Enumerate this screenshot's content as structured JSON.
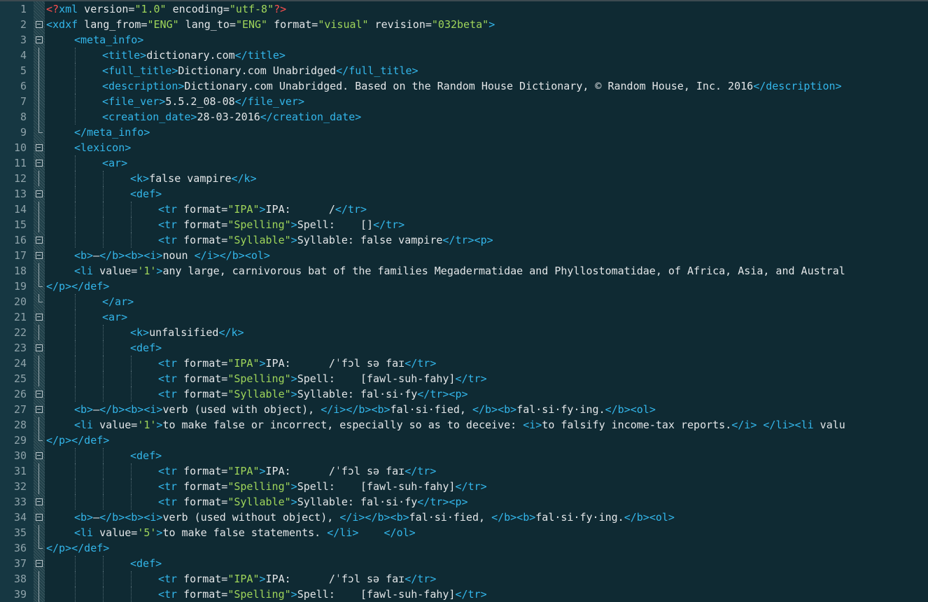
{
  "editor": {
    "language": "xml",
    "colors": {
      "background": "#0f2a33",
      "tag": "#33b6ea",
      "attribute": "#e3e6e8",
      "value": "#9fd55a",
      "text": "#e3e6e8",
      "processing_instruction": "#ff4f4f",
      "line_number": "#8fa3aa"
    },
    "lines": [
      {
        "n": "1",
        "indent": 0,
        "fold": "none",
        "tokens": [
          {
            "k": "p",
            "s": "<?"
          },
          {
            "k": "t",
            "s": "xml"
          },
          {
            "k": "a",
            "s": " version="
          },
          {
            "k": "v",
            "s": "\"1.0\""
          },
          {
            "k": "a",
            "s": " encoding="
          },
          {
            "k": "v",
            "s": "\"utf-8\""
          },
          {
            "k": "p",
            "s": "?>"
          }
        ]
      },
      {
        "n": "2",
        "indent": 0,
        "fold": "box",
        "tokens": [
          {
            "k": "t",
            "s": "<xdxf"
          },
          {
            "k": "a",
            "s": " lang_from="
          },
          {
            "k": "v",
            "s": "\"ENG\""
          },
          {
            "k": "a",
            "s": " lang_to="
          },
          {
            "k": "v",
            "s": "\"ENG\""
          },
          {
            "k": "a",
            "s": " format="
          },
          {
            "k": "v",
            "s": "\"visual\""
          },
          {
            "k": "a",
            "s": " revision="
          },
          {
            "k": "v",
            "s": "\"032beta\""
          },
          {
            "k": "t",
            "s": ">"
          }
        ]
      },
      {
        "n": "3",
        "indent": 1,
        "fold": "box",
        "tokens": [
          {
            "k": "t",
            "s": "<meta_info>"
          }
        ]
      },
      {
        "n": "4",
        "indent": 2,
        "fold": "vl",
        "tokens": [
          {
            "k": "t",
            "s": "<title>"
          },
          {
            "k": "x",
            "s": "dictionary.com"
          },
          {
            "k": "t",
            "s": "</title>"
          }
        ]
      },
      {
        "n": "5",
        "indent": 2,
        "fold": "vl",
        "tokens": [
          {
            "k": "t",
            "s": "<full_title>"
          },
          {
            "k": "x",
            "s": "Dictionary.com Unabridged"
          },
          {
            "k": "t",
            "s": "</full_title>"
          }
        ]
      },
      {
        "n": "6",
        "indent": 2,
        "fold": "vl",
        "tokens": [
          {
            "k": "t",
            "s": "<description>"
          },
          {
            "k": "x",
            "s": "Dictionary.com Unabridged. Based on the Random House Dictionary, © Random House, Inc. 2016"
          },
          {
            "k": "t",
            "s": "</description>"
          }
        ]
      },
      {
        "n": "7",
        "indent": 2,
        "fold": "vl",
        "tokens": [
          {
            "k": "t",
            "s": "<file_ver>"
          },
          {
            "k": "x",
            "s": "5.5.2_08-08"
          },
          {
            "k": "t",
            "s": "</file_ver>"
          }
        ]
      },
      {
        "n": "8",
        "indent": 2,
        "fold": "vl",
        "tokens": [
          {
            "k": "t",
            "s": "<creation_date>"
          },
          {
            "k": "x",
            "s": "28-03-2016"
          },
          {
            "k": "t",
            "s": "</creation_date>"
          }
        ]
      },
      {
        "n": "9",
        "indent": 1,
        "fold": "end",
        "tokens": [
          {
            "k": "t",
            "s": "</meta_info>"
          }
        ]
      },
      {
        "n": "10",
        "indent": 1,
        "fold": "box",
        "tokens": [
          {
            "k": "t",
            "s": "<lexicon>"
          }
        ]
      },
      {
        "n": "11",
        "indent": 2,
        "fold": "box",
        "tokens": [
          {
            "k": "t",
            "s": "<ar>"
          }
        ]
      },
      {
        "n": "12",
        "indent": 3,
        "fold": "vl",
        "tokens": [
          {
            "k": "t",
            "s": "<k>"
          },
          {
            "k": "x",
            "s": "false vampire"
          },
          {
            "k": "t",
            "s": "</k>"
          }
        ]
      },
      {
        "n": "13",
        "indent": 3,
        "fold": "box",
        "tokens": [
          {
            "k": "t",
            "s": "<def>"
          }
        ]
      },
      {
        "n": "14",
        "indent": 4,
        "fold": "vl",
        "tokens": [
          {
            "k": "t",
            "s": "<tr"
          },
          {
            "k": "a",
            "s": " format="
          },
          {
            "k": "v",
            "s": "\"IPA\""
          },
          {
            "k": "t",
            "s": ">"
          },
          {
            "k": "x",
            "s": "IPA:      /"
          },
          {
            "k": "t",
            "s": "</tr>"
          }
        ]
      },
      {
        "n": "15",
        "indent": 4,
        "fold": "vl",
        "tokens": [
          {
            "k": "t",
            "s": "<tr"
          },
          {
            "k": "a",
            "s": " format="
          },
          {
            "k": "v",
            "s": "\"Spelling\""
          },
          {
            "k": "t",
            "s": ">"
          },
          {
            "k": "x",
            "s": "Spell:    []"
          },
          {
            "k": "t",
            "s": "</tr>"
          }
        ]
      },
      {
        "n": "16",
        "indent": 4,
        "fold": "box",
        "tokens": [
          {
            "k": "t",
            "s": "<tr"
          },
          {
            "k": "a",
            "s": " format="
          },
          {
            "k": "v",
            "s": "\"Syllable\""
          },
          {
            "k": "t",
            "s": ">"
          },
          {
            "k": "x",
            "s": "Syllable: false vampire"
          },
          {
            "k": "t",
            "s": "</tr><p>"
          }
        ]
      },
      {
        "n": "17",
        "indent": 1,
        "fold": "box",
        "tokens": [
          {
            "k": "t",
            "s": "<b>"
          },
          {
            "k": "x",
            "s": "–"
          },
          {
            "k": "t",
            "s": "</b><b><i>"
          },
          {
            "k": "x",
            "s": "noun "
          },
          {
            "k": "t",
            "s": "</i></b><ol>"
          }
        ]
      },
      {
        "n": "18",
        "indent": 1,
        "fold": "vl",
        "tokens": [
          {
            "k": "t",
            "s": "<li"
          },
          {
            "k": "a",
            "s": " value="
          },
          {
            "k": "v",
            "s": "'1'"
          },
          {
            "k": "t",
            "s": ">"
          },
          {
            "k": "x",
            "s": "any large, carnivorous bat of the families Megadermatidae and Phyllostomatidae, of Africa, Asia, and Austral"
          }
        ]
      },
      {
        "n": "19",
        "indent": 0,
        "fold": "end",
        "tokens": [
          {
            "k": "t",
            "s": "</p></def>"
          }
        ]
      },
      {
        "n": "20",
        "indent": 2,
        "fold": "end",
        "tokens": [
          {
            "k": "t",
            "s": "</ar>"
          }
        ]
      },
      {
        "n": "21",
        "indent": 2,
        "fold": "box",
        "tokens": [
          {
            "k": "t",
            "s": "<ar>"
          }
        ]
      },
      {
        "n": "22",
        "indent": 3,
        "fold": "vl",
        "tokens": [
          {
            "k": "t",
            "s": "<k>"
          },
          {
            "k": "x",
            "s": "unfalsified"
          },
          {
            "k": "t",
            "s": "</k>"
          }
        ]
      },
      {
        "n": "23",
        "indent": 3,
        "fold": "box",
        "tokens": [
          {
            "k": "t",
            "s": "<def>"
          }
        ]
      },
      {
        "n": "24",
        "indent": 4,
        "fold": "vl",
        "tokens": [
          {
            "k": "t",
            "s": "<tr"
          },
          {
            "k": "a",
            "s": " format="
          },
          {
            "k": "v",
            "s": "\"IPA\""
          },
          {
            "k": "t",
            "s": ">"
          },
          {
            "k": "x",
            "s": "IPA:      /ˈfɔl sə faɪ"
          },
          {
            "k": "t",
            "s": "</tr>"
          }
        ]
      },
      {
        "n": "25",
        "indent": 4,
        "fold": "vl",
        "tokens": [
          {
            "k": "t",
            "s": "<tr"
          },
          {
            "k": "a",
            "s": " format="
          },
          {
            "k": "v",
            "s": "\"Spelling\""
          },
          {
            "k": "t",
            "s": ">"
          },
          {
            "k": "x",
            "s": "Spell:    [fawl-suh-fahy]"
          },
          {
            "k": "t",
            "s": "</tr>"
          }
        ]
      },
      {
        "n": "26",
        "indent": 4,
        "fold": "box",
        "tokens": [
          {
            "k": "t",
            "s": "<tr"
          },
          {
            "k": "a",
            "s": " format="
          },
          {
            "k": "v",
            "s": "\"Syllable\""
          },
          {
            "k": "t",
            "s": ">"
          },
          {
            "k": "x",
            "s": "Syllable: fal·si·fy"
          },
          {
            "k": "t",
            "s": "</tr><p>"
          }
        ]
      },
      {
        "n": "27",
        "indent": 1,
        "fold": "box",
        "tokens": [
          {
            "k": "t",
            "s": "<b>"
          },
          {
            "k": "x",
            "s": "–"
          },
          {
            "k": "t",
            "s": "</b><b><i>"
          },
          {
            "k": "x",
            "s": "verb (used with object), "
          },
          {
            "k": "t",
            "s": "</i></b><b>"
          },
          {
            "k": "x",
            "s": "fal·si·fied, "
          },
          {
            "k": "t",
            "s": "</b><b>"
          },
          {
            "k": "x",
            "s": "fal·si·fy·ing."
          },
          {
            "k": "t",
            "s": "</b><ol>"
          }
        ]
      },
      {
        "n": "28",
        "indent": 1,
        "fold": "vl",
        "tokens": [
          {
            "k": "t",
            "s": "<li"
          },
          {
            "k": "a",
            "s": " value="
          },
          {
            "k": "v",
            "s": "'1'"
          },
          {
            "k": "t",
            "s": ">"
          },
          {
            "k": "x",
            "s": "to make false or incorrect, especially so as to deceive: "
          },
          {
            "k": "t",
            "s": "<i>"
          },
          {
            "k": "x",
            "s": "to falsify income-tax reports."
          },
          {
            "k": "t",
            "s": "</i>"
          },
          {
            "k": "x",
            "s": " "
          },
          {
            "k": "t",
            "s": "</li><li"
          },
          {
            "k": "a",
            "s": " valu"
          }
        ]
      },
      {
        "n": "29",
        "indent": 0,
        "fold": "end",
        "tokens": [
          {
            "k": "t",
            "s": "</p></def>"
          }
        ]
      },
      {
        "n": "30",
        "indent": 3,
        "fold": "box",
        "tokens": [
          {
            "k": "t",
            "s": "<def>"
          }
        ]
      },
      {
        "n": "31",
        "indent": 4,
        "fold": "vl",
        "tokens": [
          {
            "k": "t",
            "s": "<tr"
          },
          {
            "k": "a",
            "s": " format="
          },
          {
            "k": "v",
            "s": "\"IPA\""
          },
          {
            "k": "t",
            "s": ">"
          },
          {
            "k": "x",
            "s": "IPA:      /ˈfɔl sə faɪ"
          },
          {
            "k": "t",
            "s": "</tr>"
          }
        ]
      },
      {
        "n": "32",
        "indent": 4,
        "fold": "vl",
        "tokens": [
          {
            "k": "t",
            "s": "<tr"
          },
          {
            "k": "a",
            "s": " format="
          },
          {
            "k": "v",
            "s": "\"Spelling\""
          },
          {
            "k": "t",
            "s": ">"
          },
          {
            "k": "x",
            "s": "Spell:    [fawl-suh-fahy]"
          },
          {
            "k": "t",
            "s": "</tr>"
          }
        ]
      },
      {
        "n": "33",
        "indent": 4,
        "fold": "box",
        "tokens": [
          {
            "k": "t",
            "s": "<tr"
          },
          {
            "k": "a",
            "s": " format="
          },
          {
            "k": "v",
            "s": "\"Syllable\""
          },
          {
            "k": "t",
            "s": ">"
          },
          {
            "k": "x",
            "s": "Syllable: fal·si·fy"
          },
          {
            "k": "t",
            "s": "</tr><p>"
          }
        ]
      },
      {
        "n": "34",
        "indent": 1,
        "fold": "box",
        "tokens": [
          {
            "k": "t",
            "s": "<b>"
          },
          {
            "k": "x",
            "s": "–"
          },
          {
            "k": "t",
            "s": "</b><b><i>"
          },
          {
            "k": "x",
            "s": "verb (used without object), "
          },
          {
            "k": "t",
            "s": "</i></b><b>"
          },
          {
            "k": "x",
            "s": "fal·si·fied, "
          },
          {
            "k": "t",
            "s": "</b><b>"
          },
          {
            "k": "x",
            "s": "fal·si·fy·ing."
          },
          {
            "k": "t",
            "s": "</b><ol>"
          }
        ]
      },
      {
        "n": "35",
        "indent": 1,
        "fold": "vl",
        "tokens": [
          {
            "k": "t",
            "s": "<li"
          },
          {
            "k": "a",
            "s": " value="
          },
          {
            "k": "v",
            "s": "'5'"
          },
          {
            "k": "t",
            "s": ">"
          },
          {
            "k": "x",
            "s": "to make false statements. "
          },
          {
            "k": "t",
            "s": "</li>"
          },
          {
            "k": "x",
            "s": "    "
          },
          {
            "k": "t",
            "s": "</ol>"
          }
        ]
      },
      {
        "n": "36",
        "indent": 0,
        "fold": "end",
        "tokens": [
          {
            "k": "t",
            "s": "</p></def>"
          }
        ]
      },
      {
        "n": "37",
        "indent": 3,
        "fold": "box",
        "tokens": [
          {
            "k": "t",
            "s": "<def>"
          }
        ]
      },
      {
        "n": "38",
        "indent": 4,
        "fold": "vl",
        "tokens": [
          {
            "k": "t",
            "s": "<tr"
          },
          {
            "k": "a",
            "s": " format="
          },
          {
            "k": "v",
            "s": "\"IPA\""
          },
          {
            "k": "t",
            "s": ">"
          },
          {
            "k": "x",
            "s": "IPA:      /ˈfɔl sə faɪ"
          },
          {
            "k": "t",
            "s": "</tr>"
          }
        ]
      },
      {
        "n": "39",
        "indent": 4,
        "fold": "vl",
        "tokens": [
          {
            "k": "t",
            "s": "<tr"
          },
          {
            "k": "a",
            "s": " format="
          },
          {
            "k": "v",
            "s": "\"Spelling\""
          },
          {
            "k": "t",
            "s": ">"
          },
          {
            "k": "x",
            "s": "Spell:    [fawl-suh-fahy]"
          },
          {
            "k": "t",
            "s": "</tr>"
          }
        ]
      }
    ]
  }
}
